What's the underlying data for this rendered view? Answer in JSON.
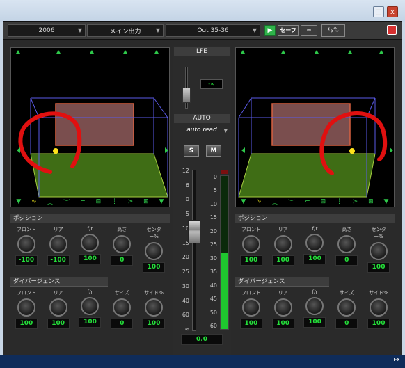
{
  "titlebar": {
    "restore_icon": "restore-icon",
    "close_label": "x"
  },
  "toolbar": {
    "track": "2006",
    "output_name": "メイン出力",
    "output_path": "Out 35-36",
    "safe_label": "セーフ"
  },
  "lfe": {
    "label": "LFE",
    "readout": "-∞"
  },
  "center": {
    "auto_label": "AUTO",
    "auto_mode": "auto read",
    "solo": "S",
    "mute": "M",
    "fader_scale": [
      "12",
      "6",
      "0",
      "5",
      "10",
      "15",
      "20",
      "25",
      "30",
      "40",
      "60",
      "∞"
    ],
    "meter_scale": [
      "0",
      "5",
      "10",
      "15",
      "20",
      "25",
      "30",
      "35",
      "40",
      "45",
      "50",
      "60"
    ],
    "volume": "0.0"
  },
  "left": {
    "position_header": "ポジション",
    "position_knobs": [
      {
        "label": "フロント",
        "value": "-100"
      },
      {
        "label": "リア",
        "value": "-100"
      },
      {
        "label": "f/r",
        "value": "100"
      },
      {
        "label": "高さ",
        "value": "0"
      },
      {
        "label": "センター%",
        "value": "100"
      }
    ],
    "divergence_header": "ダイバージェンス",
    "divergence_knobs": [
      {
        "label": "フロント",
        "value": "100"
      },
      {
        "label": "リア",
        "value": "100"
      },
      {
        "label": "f/r",
        "value": "100"
      },
      {
        "label": "サイズ",
        "value": "0"
      },
      {
        "label": "サイド%",
        "value": "100"
      }
    ]
  },
  "right": {
    "position_header": "ポジション",
    "position_knobs": [
      {
        "label": "フロント",
        "value": "100"
      },
      {
        "label": "リア",
        "value": "100"
      },
      {
        "label": "f/r",
        "value": "100"
      },
      {
        "label": "高さ",
        "value": "0"
      },
      {
        "label": "センター%",
        "value": "100"
      }
    ],
    "divergence_header": "ダイバージェンス",
    "divergence_knobs": [
      {
        "label": "フロント",
        "value": "100"
      },
      {
        "label": "リア",
        "value": "100"
      },
      {
        "label": "f/r",
        "value": "100"
      },
      {
        "label": "サイズ",
        "value": "0"
      },
      {
        "label": "サイド%",
        "value": "100"
      }
    ]
  },
  "meter": {
    "level_fraction": 0.5,
    "peak_color": "#e02020",
    "meter_color": "#1fc72f"
  },
  "colors": {
    "accent_green": "#24e03a",
    "scribble_red": "#e01010",
    "grid_blue": "#5a5ae8"
  }
}
